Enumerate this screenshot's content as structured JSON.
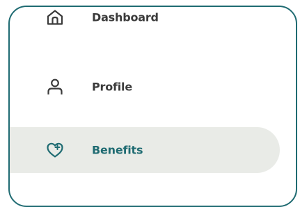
{
  "nav": {
    "items": [
      {
        "label": "Dashboard",
        "icon": "home-icon",
        "active": false
      },
      {
        "label": "Profile",
        "icon": "user-icon",
        "active": false
      },
      {
        "label": "Benefits",
        "icon": "heart-plus-icon",
        "active": true
      }
    ]
  },
  "colors": {
    "accent": "#1f6b72",
    "text": "#3b3b3b",
    "active_bg": "#e9ebe7",
    "border": "#1f6b72"
  }
}
